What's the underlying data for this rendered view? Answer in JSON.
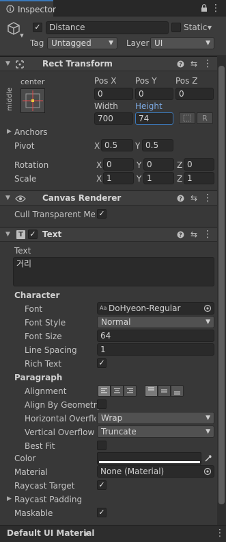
{
  "tab": {
    "label": "Inspector"
  },
  "object": {
    "active": true,
    "name": "Distance",
    "static_label": "Static",
    "static": false,
    "tag_label": "Tag",
    "tag_value": "Untagged",
    "layer_label": "Layer",
    "layer_value": "UI"
  },
  "rect_transform": {
    "title": "Rect Transform",
    "anchor_h": "center",
    "anchor_v": "middle",
    "pos_x_label": "Pos X",
    "pos_y_label": "Pos Y",
    "pos_z_label": "Pos Z",
    "pos_x": "0",
    "pos_y": "0",
    "pos_z": "0",
    "width_label": "Width",
    "height_label": "Height",
    "width": "700",
    "height": "74",
    "r_button": "R",
    "anchors_label": "Anchors",
    "pivot_label": "Pivot",
    "pivot_x": "0.5",
    "pivot_y": "0.5",
    "rotation_label": "Rotation",
    "rot_x": "0",
    "rot_y": "0",
    "rot_z": "0",
    "scale_label": "Scale",
    "scale_x": "1",
    "scale_y": "1",
    "scale_z": "1",
    "x": "X",
    "y": "Y",
    "z": "Z"
  },
  "canvas_renderer": {
    "title": "Canvas Renderer",
    "cull_label": "Cull Transparent Mes",
    "cull": true
  },
  "text_comp": {
    "title": "Text",
    "enabled": true,
    "text_label": "Text",
    "text_value": "거리",
    "character_label": "Character",
    "font_label": "Font",
    "font_value": "DoHyeon-Regular",
    "font_style_label": "Font Style",
    "font_style_value": "Normal",
    "font_size_label": "Font Size",
    "font_size_value": "64",
    "line_spacing_label": "Line Spacing",
    "line_spacing_value": "1",
    "rich_text_label": "Rich Text",
    "rich_text": true,
    "paragraph_label": "Paragraph",
    "alignment_label": "Alignment",
    "align_geometry_label": "Align By Geometry",
    "align_geometry": false,
    "h_overflow_label": "Horizontal Overflo",
    "h_overflow_value": "Wrap",
    "v_overflow_label": "Vertical Overflow",
    "v_overflow_value": "Truncate",
    "best_fit_label": "Best Fit",
    "best_fit": false,
    "color_label": "Color",
    "color_value": "#ffffff",
    "material_label": "Material",
    "material_value": "None (Material)",
    "raycast_target_label": "Raycast Target",
    "raycast_target": true,
    "raycast_padding_label": "Raycast Padding",
    "maskable_label": "Maskable",
    "maskable": true
  },
  "footer": {
    "material_name": "Default UI Material"
  },
  "colors": {
    "accent": "#3a79bb",
    "height_label": "#7ba8e0"
  }
}
